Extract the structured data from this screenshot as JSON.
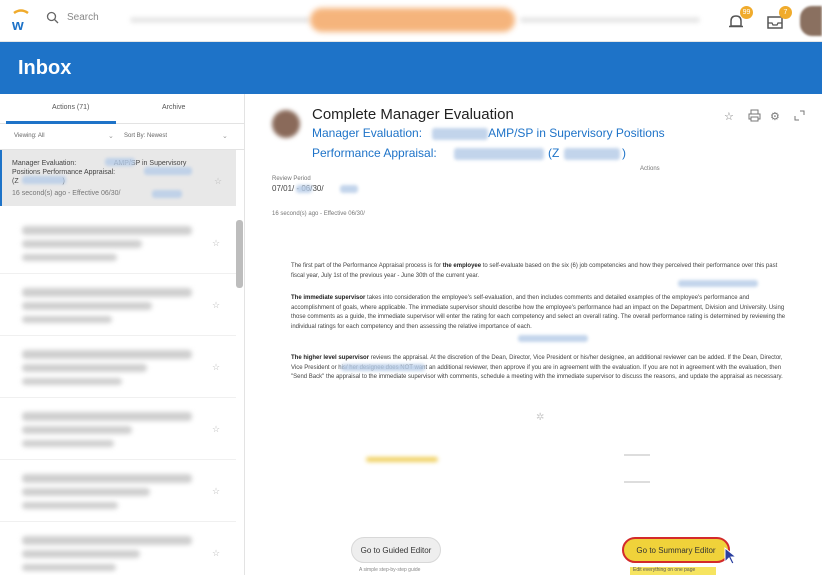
{
  "topbar": {
    "search_placeholder": "Search",
    "notif_count_1": "99",
    "notif_count_2": "7"
  },
  "header": {
    "title": "Inbox"
  },
  "left": {
    "tab_actions": "Actions (71)",
    "tab_archive": "Archive",
    "viewing_label": "Viewing: All",
    "sort_label": "Sort By: Newest",
    "active_item": {
      "line1": "Manager Evaluation:",
      "line1b": "AMP/SP in Supervisory",
      "line2": "Positions Performance Appraisal:",
      "line3": "(Z",
      "line3b": ")",
      "meta": "16 second(s) ago - Effective 06/30/"
    }
  },
  "main": {
    "title": "Complete Manager Evaluation",
    "sub1_prefix": "Manager Evaluation:",
    "sub1_suffix": "AMP/SP in Supervisory Positions",
    "sub2_prefix": "Performance Appraisal:",
    "sub2_mid": "(Z",
    "sub2_end": ")",
    "actions_chip": "Actions",
    "review_label": "Review Period",
    "review_date": "07/01/     - 06/30/",
    "timeline": "16 second(s) ago - Effective 06/30/",
    "p1_pre": "The first part of the Performance Appraisal process is for ",
    "p1_bold": "the employee",
    "p1_post": " to self-evaluate based on the six (6) job competencies and how they perceived their performance over this past fiscal year, July 1st of the previous year - June 30th of the current year.",
    "p2_bold": "The immediate supervisor",
    "p2_post": " takes into consideration the employee's self-evaluation, and then includes comments and detailed examples of the employee's performance and accomplishment of goals, where applicable. The immediate supervisor should describe how the employee's performance had an impact on the Department, Division and University. Using those comments as a guide, the immediate supervisor will enter the rating for each competency and select an overall rating. The overall performance rating is determined by reviewing the individual ratings for each competency and then assessing the relative importance of each.",
    "p3_bold": "The higher level supervisor",
    "p3_post": " reviews the appraisal. At the discretion of the Dean, Director, Vice President or his/her designee, an additional reviewer can be added. If the Dean, Director, Vice President or his/ her designee does NOT want an additional reviewer, then approve if you are in agreement with the evaluation. If you are not in agreement with the evaluation, then \"Send Back\" the appraisal to the immediate supervisor with comments, schedule a meeting with the immediate supervisor to discuss the reasons, and update the appraisal as necessary.",
    "btn_guided": "Go to Guided Editor",
    "guided_caption": "A simple step-by-step guide",
    "btn_summary": "Go to Summary Editor",
    "summary_caption": "Edit everything on one page"
  },
  "colors": {
    "brand_blue": "#1e73c8",
    "summary_button": "#f0d23a",
    "highlight_ring": "#d32a2a",
    "notif_badge": "#f0ab2c"
  },
  "icons": [
    "workday-logo-icon",
    "search-icon",
    "bell-icon",
    "inbox-tray-icon",
    "star-icon",
    "print-icon",
    "gear-icon",
    "expand-icon",
    "cursor-icon"
  ]
}
